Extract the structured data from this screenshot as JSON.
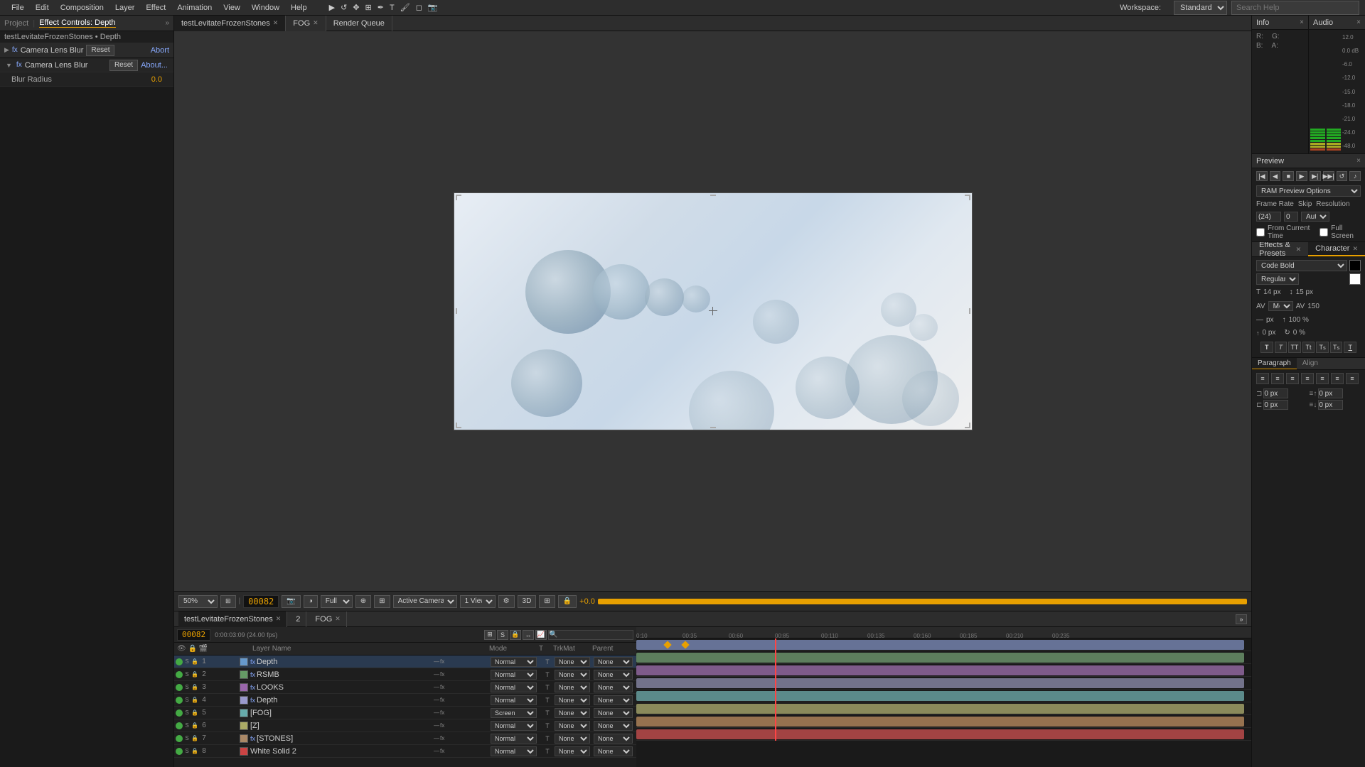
{
  "menubar": {
    "items": [
      "File",
      "Edit",
      "Composition",
      "Layer",
      "Effect",
      "Animation",
      "View",
      "Window",
      "Help"
    ]
  },
  "toolbar": {
    "workspace_label": "Workspace:",
    "workspace_value": "Standard",
    "search_placeholder": "Search Help"
  },
  "left_panel": {
    "tabs": [
      "Project",
      "Effect Controls: Depth"
    ],
    "breadcrumb": "testLevitateFrozenStones • Depth",
    "layer_name": "Camera Lens Blur",
    "reset_btn": "Reset",
    "about_btn": "About...",
    "abort_btn": "Abort",
    "effect_name": "Camera Lens Blur",
    "blur_radius_label": "Blur Radius",
    "blur_radius_value": "0.0"
  },
  "composition_tabs": [
    {
      "label": "testLevitateFrozenStones",
      "active": true
    },
    {
      "label": "FOG",
      "active": false
    }
  ],
  "render_queue": "Render Queue",
  "viewer": {
    "timecode": "00082",
    "time_display": "0:00:03:09 (24.00 fps)",
    "zoom": "50%",
    "quality": "Full",
    "camera": "Active Camera",
    "view": "1 View",
    "offset": "+0.0"
  },
  "timeline": {
    "tabs": [
      "testLevitateFrozenStones",
      "2",
      "FOG"
    ],
    "timecode": "00082",
    "time_fps": "0:00:03:09 (24.00 fps)",
    "search_placeholder": "🔍",
    "layers": [
      {
        "num": 1,
        "name": "Depth",
        "mode": "Normal",
        "has_fx": true,
        "color": "#6699cc",
        "track_color": "#8899cc"
      },
      {
        "num": 2,
        "name": "RSMB",
        "mode": "Normal",
        "has_fx": true,
        "color": "#669966",
        "track_color": "#7aaa7a"
      },
      {
        "num": 3,
        "name": "LOOKS",
        "mode": "Normal",
        "has_fx": true,
        "color": "#9966aa",
        "track_color": "#aa77bb"
      },
      {
        "num": 4,
        "name": "Depth",
        "mode": "Normal",
        "has_fx": true,
        "color": "#9999cc",
        "track_color": "#9999bb"
      },
      {
        "num": 5,
        "name": "[FOG]",
        "mode": "Screen",
        "has_fx": false,
        "color": "#66aaaa",
        "track_color": "#77bbbb"
      },
      {
        "num": 6,
        "name": "[Z]",
        "mode": "Normal",
        "has_fx": false,
        "color": "#aaaa66",
        "track_color": "#bbbb77"
      },
      {
        "num": 7,
        "name": "[STONES]",
        "mode": "Normal",
        "has_fx": true,
        "color": "#aa8866",
        "track_color": "#cc9966"
      },
      {
        "num": 8,
        "name": "White Solid 2",
        "mode": "Normal",
        "has_fx": false,
        "color": "#cc4444",
        "track_color": "#dd5555"
      }
    ],
    "ruler_marks": [
      "0:10",
      "00:35",
      "00:60",
      "00:85",
      "00:110",
      "00:135",
      "00:160",
      "00:185",
      "00:210",
      "00:235"
    ]
  },
  "info_panel": {
    "title": "Info",
    "close": "×"
  },
  "audio_panel": {
    "title": "Audio",
    "close": "×",
    "scale": [
      "12.0",
      "0.0 dB",
      "-6.0",
      "-12.0",
      "-15.0",
      "-18.0",
      "-21.0",
      "-24.0",
      "-48.0"
    ]
  },
  "preview_panel": {
    "title": "Preview",
    "close": "×",
    "ram_preview_label": "RAM Preview Options",
    "frame_rate_label": "Frame Rate",
    "skip_label": "Skip",
    "resolution_label": "Resolution",
    "frame_rate_value": "(24)",
    "skip_value": "0",
    "resolution_value": "Auto",
    "from_current_label": "From Current Time",
    "full_screen_label": "Full Screen"
  },
  "effects_panel": {
    "tabs": [
      "Effects & Presets",
      "Character"
    ],
    "font_name": "Code Bold",
    "font_style": "Regular",
    "font_size": "14 px",
    "line_height": "15 px",
    "tracking_label": "Metrics",
    "tracking_value": "150",
    "indent_label": "px",
    "size_100": "100 %",
    "rotate_0": "0 %"
  },
  "paragraph_panel": {
    "title": "Paragraph",
    "align_title": "Align"
  }
}
